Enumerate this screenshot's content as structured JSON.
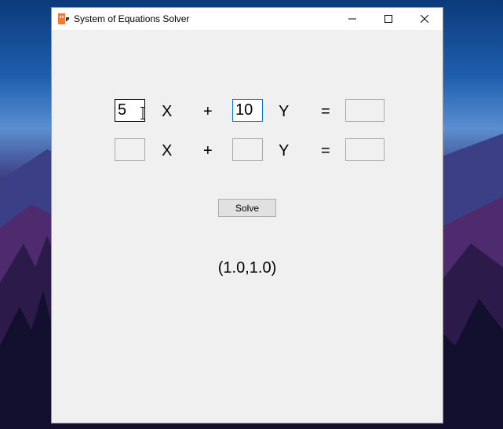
{
  "window": {
    "title": "System of Equations Solver"
  },
  "equation_1": {
    "a_value": "5",
    "x_label": "X",
    "plus_label": "+",
    "b_value": "10",
    "y_label": "Y",
    "equals_label": "=",
    "c_value": ""
  },
  "equation_2": {
    "a_value": "",
    "x_label": "X",
    "plus_label": "+",
    "b_value": "",
    "y_label": "Y",
    "equals_label": "=",
    "c_value": ""
  },
  "solve_label": "Solve",
  "result_text": "(1.0,1.0)",
  "colors": {
    "window_bg": "#f0f0f0",
    "titlebar_bg": "#ffffff",
    "focus_border": "#0078d7",
    "app_icon": "#f07c3a"
  },
  "icons": [
    "app-icon",
    "minimize-icon",
    "maximize-icon",
    "close-icon",
    "text-cursor-icon"
  ]
}
